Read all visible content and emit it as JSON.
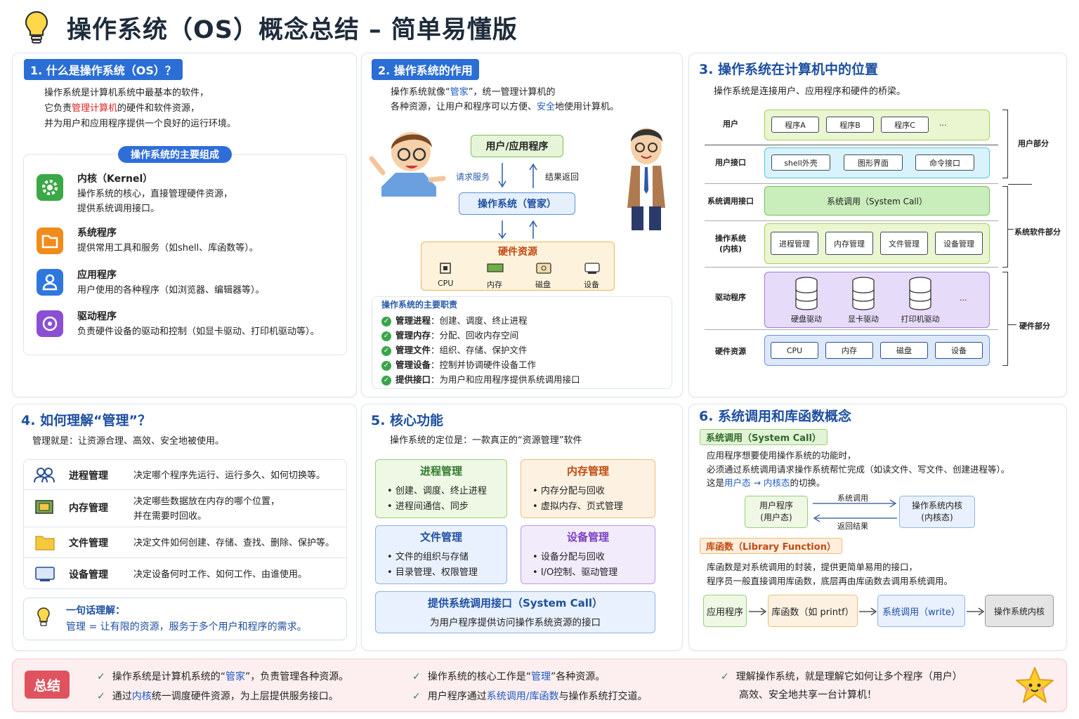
{
  "title": "操作系统（OS）概念总结 – 简单易懂版",
  "icons": {
    "title": "lightbulb-icon"
  },
  "p1": {
    "tag": "1. 什么是操作系统（OS）？",
    "l1": "操作系统是计算机系统中最基本的软件，",
    "l2a": "它负责",
    "l2b": "管理计算机",
    "l2c": "的硬件和软件资源，",
    "l3": "并为用户和应用程序提供一个良好的运行环境。",
    "pill": "操作系统的主要组成",
    "items": [
      {
        "t": "内核（Kernel）",
        "d1": "操作系统的核心，直接管理硬件资源，",
        "d2": "提供系统调用接口。",
        "icon": "gear-icon"
      },
      {
        "t": "系统程序",
        "d1": "提供常用工具和服务（如shell、库函数等）。",
        "d2": "",
        "icon": "folder-icon"
      },
      {
        "t": "应用程序",
        "d1": "用户使用的各种程序（如浏览器、编辑器等）。",
        "d2": "",
        "icon": "user-icon"
      },
      {
        "t": "驱动程序",
        "d1": "负责硬件设备的驱动和控制（如显卡驱动、打印机驱动等）。",
        "d2": "",
        "icon": "driver-icon"
      }
    ]
  },
  "p2": {
    "tag": "2. 操作系统的作用",
    "l1a": "操作系统就像“",
    "l1b": "管家",
    "l1c": "”，统一管理计算机的",
    "l2a": "各种资源，让用户和程序可以方便、",
    "l2b": "安全",
    "l2c": "地使用计算机。",
    "user_box": "用户/应用程序",
    "req": "请求服务",
    "ret": "结果返回",
    "os_box": "操作系统（管家）",
    "hw_title": "硬件资源",
    "hw": [
      "CPU",
      "内存",
      "磁盘",
      "设备"
    ],
    "duty_title": "操作系统的主要职责",
    "duties": [
      {
        "b": "管理进程",
        "t": "：创建、调度、终止进程"
      },
      {
        "b": "管理内存",
        "t": "：分配、回收内存空间"
      },
      {
        "b": "管理文件",
        "t": "：组织、存储、保护文件"
      },
      {
        "b": "管理设备",
        "t": "：控制并协调硬件设备工作"
      },
      {
        "b": "提供接口",
        "t": "：为用户和应用程序提供系统调用接口"
      }
    ]
  },
  "p3": {
    "title": "3. 操作系统在计算机中的位置",
    "sub": "操作系统是连接用户、应用程序和硬件的桥梁。",
    "rows": {
      "user": "用户",
      "ui": "用户接口",
      "sc": "系统调用接口",
      "kernel": "操作系统\n(内核)",
      "drv": "驱动程序",
      "hw": "硬件资源"
    },
    "progs": [
      "程序A",
      "程序B",
      "程序C",
      "..."
    ],
    "uis": [
      "shell外壳",
      "图形界面",
      "命令接口"
    ],
    "syscall": "系统调用（System Call）",
    "kmods": [
      "进程管理",
      "内存管理",
      "文件管理",
      "设备管理"
    ],
    "drivers": [
      "硬盘驱动",
      "显卡驱动",
      "打印机驱动",
      "..."
    ],
    "hws": [
      "CPU",
      "内存",
      "磁盘",
      "设备"
    ],
    "groups": [
      "用户部分",
      "系统软件部分",
      "硬件部分"
    ]
  },
  "p4": {
    "title": "4. 如何理解“管理”？",
    "sub": "管理就是：让资源合理、高效、安全地被使用。",
    "rows": [
      {
        "t": "进程管理",
        "d1": "决定哪个程序先运行、运行多久、如何切换等。",
        "d2": "",
        "icon": "people-icon"
      },
      {
        "t": "内存管理",
        "d1": "决定哪些数据放在内存的哪个位置，",
        "d2": "并在需要时回收。",
        "icon": "memory-chip-icon"
      },
      {
        "t": "文件管理",
        "d1": "决定文件如何创建、存储、查找、删除、保护等。",
        "d2": "",
        "icon": "folder-icon"
      },
      {
        "t": "设备管理",
        "d1": "决定设备何时工作、如何工作、由谁使用。",
        "d2": "",
        "icon": "device-icon"
      }
    ],
    "tip_t": "一句话理解：",
    "tip_d": "管理 = 让有限的资源，服务于多个用户和程序的需求。"
  },
  "p5": {
    "title": "5. 核心功能",
    "sub": "操作系统的定位是：一款真正的“资源管理”软件",
    "boxes": [
      {
        "t": "进程管理",
        "a": "创建、调度、终止进程",
        "b": "进程间通信、同步"
      },
      {
        "t": "内存管理",
        "a": "内存分配与回收",
        "b": "虚拟内存、页式管理"
      },
      {
        "t": "文件管理",
        "a": "文件的组织与存储",
        "b": "目录管理、权限管理"
      },
      {
        "t": "设备管理",
        "a": "设备分配与回收",
        "b": "I/O控制、驱动管理"
      }
    ],
    "api_t": "提供系统调用接口（System Call）",
    "api_d": "为用户程序提供访问操作系统资源的接口"
  },
  "p6": {
    "title": "6. 系统调用和库函数概念",
    "sc_tag": "系统调用（System Call）",
    "sc_l1": "应用程序想要使用操作系统的功能时，",
    "sc_l2": "必须通过系统调用请求操作系统帮忙完成（如读文件、写文件、创建进程等）。",
    "sc_l3a": "这是",
    "sc_l3b": "用户态 → 内核态",
    "sc_l3c": "的切换。",
    "app_box": "用户程序\n(用户态)",
    "kern_box": "操作系统内核\n(内核态)",
    "arrow_sc": "系统调用",
    "arrow_ret": "返回结果",
    "lib_tag": "库函数（Library Function）",
    "lib_l1": "库函数是对系统调用的封装，提供更简单易用的接口，",
    "lib_l2": "程序员一般直接调用库函数，底层再由库函数去调用系统调用。",
    "flow": [
      "应用程序",
      "库函数（如 printf）",
      "系统调用（write）",
      "操作系统内核"
    ]
  },
  "summary": {
    "tag": "总结",
    "c1a": "操作系统是计算机系统的“",
    "c1b": "管家",
    "c1c": "”，负责管理各种资源。",
    "c2a": "通过",
    "c2b": "内核",
    "c2c": "统一调度硬件资源，为上层提供服务接口。",
    "c3a": "操作系统的核心工作是“",
    "c3b": "管理",
    "c3c": "”各种资源。",
    "c4a": "用户程序通过",
    "c4b": "系统调用/库函数",
    "c4c": "与操作系统打交道。",
    "c5": "理解操作系统，就是理解它如何让多个程序（用户）",
    "c6": "高效、安全地共享一台计算机！",
    "icon": "star-icon"
  }
}
